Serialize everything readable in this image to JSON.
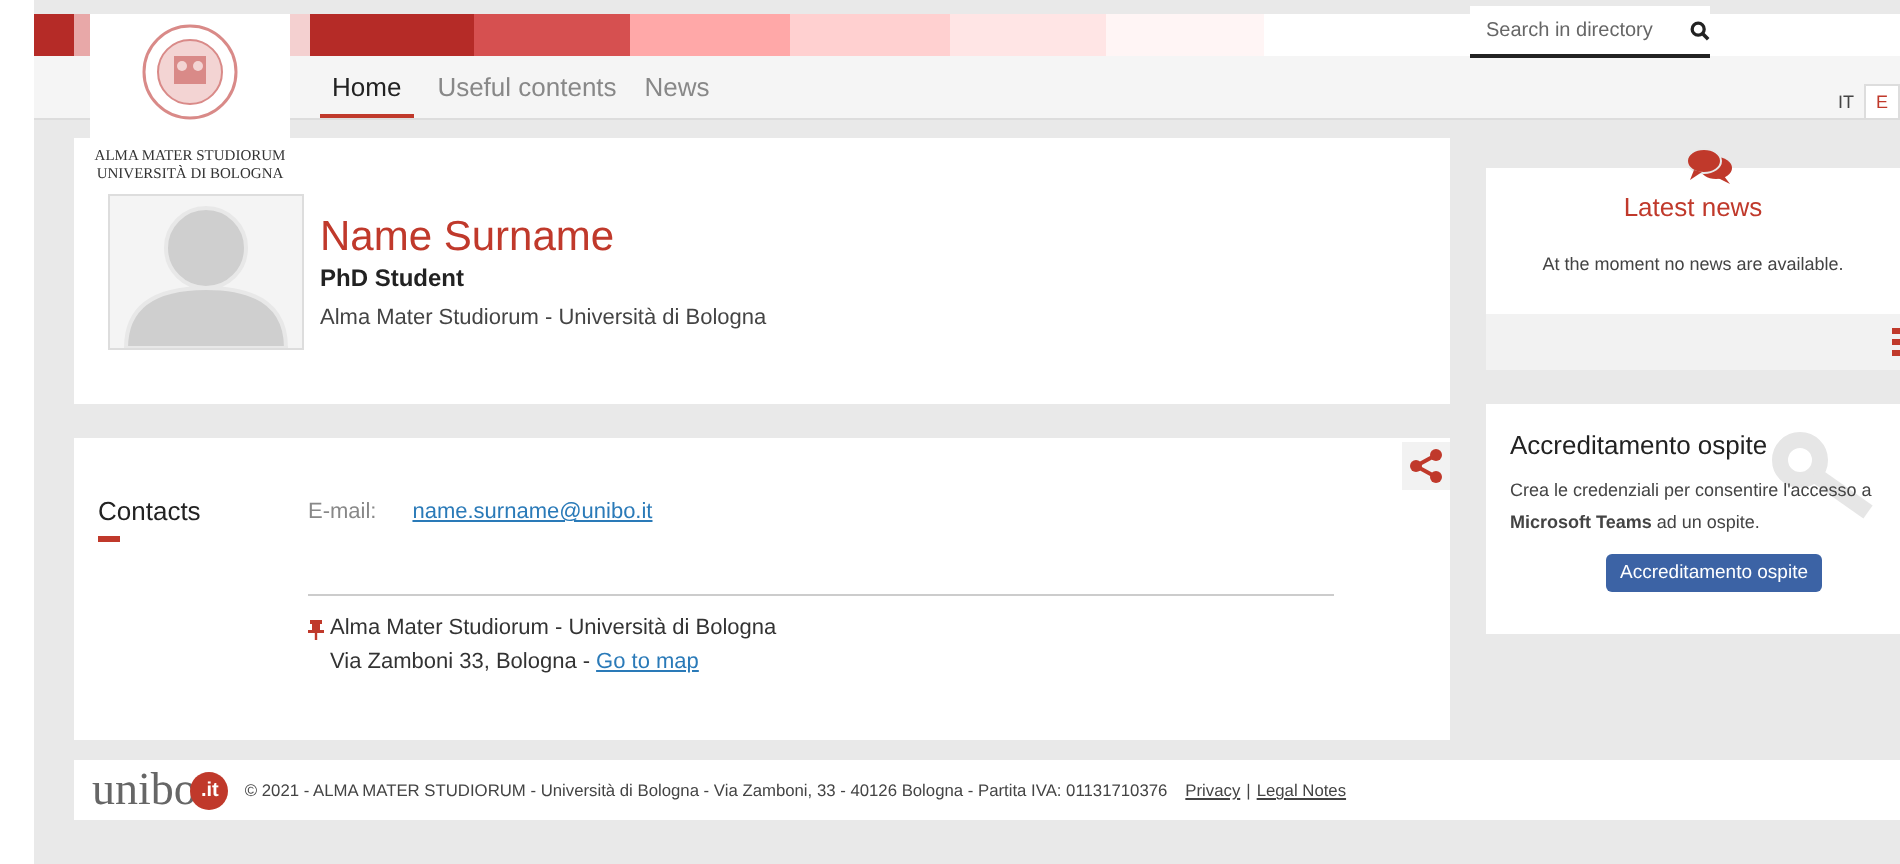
{
  "logo": {
    "line1": "ALMA MATER STUDIORUM",
    "line2": "UNIVERSITÀ DI BOLOGNA"
  },
  "search": {
    "placeholder": "Search in directory"
  },
  "nav": [
    {
      "label": "Home",
      "selected": true
    },
    {
      "label": "Useful contents",
      "selected": false
    },
    {
      "label": "News",
      "selected": false
    }
  ],
  "languages": [
    {
      "label": "IT",
      "selected": false
    },
    {
      "label": "E",
      "selected": true
    }
  ],
  "profile": {
    "name": "Name Surname",
    "role": "PhD Student",
    "affiliation": "Alma Mater Studiorum - Università di Bologna"
  },
  "contacts": {
    "title": "Contacts",
    "email_label": "E-mail:",
    "email": "name.surname@unibo.it",
    "address_line1": "Alma Mater Studiorum - Università di Bologna",
    "address_line2": "Via Zamboni 33, Bologna -",
    "map_link": "Go to map"
  },
  "news": {
    "title": "Latest news",
    "message": "At the moment no news are available."
  },
  "guest": {
    "title": "Accreditamento ospite",
    "text": "Crea le credenziali per consentire l'accesso a **Microsoft Teams** ad un ospite.",
    "button": "Accreditamento ospite"
  },
  "footer": {
    "logo_text": "unibo",
    "logo_badge": ".it",
    "copyright": "© 2021 - ALMA MATER STUDIORUM - Università di Bologna - Via Zamboni, 33 - 40126 Bologna - Partita IVA: 01131710376",
    "links": [
      "Privacy",
      "Legal Notes"
    ],
    "separator": "|"
  }
}
